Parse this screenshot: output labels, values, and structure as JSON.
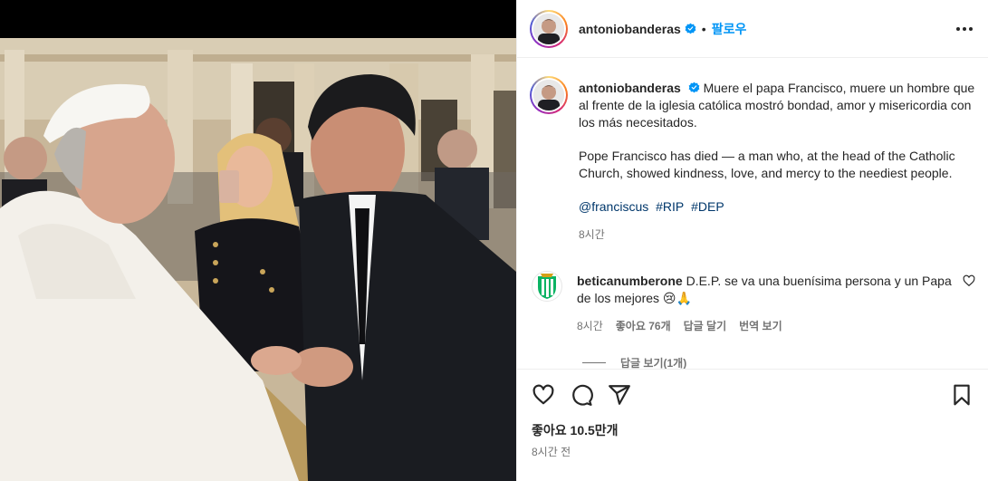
{
  "post": {
    "username": "antoniobanderas",
    "follow_label": "팔로우",
    "dot": "•",
    "more_icon": "more-horizontal-icon"
  },
  "caption": {
    "username": "antoniobanderas",
    "spanish": "Muere el papa Francisco, muere un hombre que al frente de la iglesia católica mostró bondad, amor y misericordia con los más necesitados.",
    "english": "Pope Francisco has died — a man who, at the head of the Catholic Church, showed kindness, love, and mercy to the neediest people.",
    "tags": [
      "@franciscus",
      "#RIP",
      "#DEP"
    ],
    "time": "8시간"
  },
  "comment": {
    "username": "beticanumberone",
    "text": "D.E.P. se va una buenísima persona y un Papa de los mejores 😢🙏",
    "time": "8시간",
    "likes": "좋아요 76개",
    "reply": "답글 달기",
    "translate": "번역 보기",
    "view_replies": "답글 보기(1개)"
  },
  "footer": {
    "likes": "좋아요 10.5만개",
    "date": "8시간 전"
  },
  "colors": {
    "link": "#00376b",
    "follow": "#0095f6",
    "muted": "#737373",
    "verified": "#0095f6",
    "betis_green": "#0bb363"
  }
}
